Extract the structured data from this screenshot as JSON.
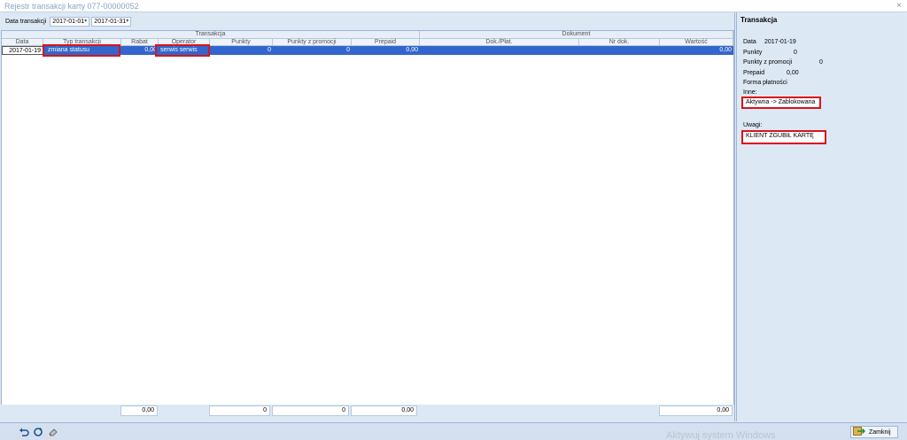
{
  "window": {
    "title": "Rejestr transakcji karty 077-00000052",
    "close_glyph": "×"
  },
  "filter": {
    "label": "Data transakcji",
    "from": "2017-01-01",
    "to": "2017-01-31"
  },
  "grid": {
    "bands": {
      "transakcja": "Transakcja",
      "dokument": "Dokument"
    },
    "columns": {
      "data": "Data",
      "typ": "Typ transakcji",
      "rabat": "Rabat",
      "operator": "Operator",
      "punkty": "Punkty",
      "punkty_promocji": "Punkty z promocji",
      "prepaid": "Prepaid",
      "dok": "Dok./Płat.",
      "nrdok": "Nr dok.",
      "wartosc": "Wartość"
    },
    "row": {
      "data": "2017-01-19",
      "typ": "zmiana statusu",
      "rabat": "0,00",
      "operator": "serwis serwis",
      "punkty": "0",
      "punkty_promocji": "0",
      "prepaid": "0,00",
      "dok": "",
      "nrdok": "",
      "wartosc": "0,00"
    },
    "totals": {
      "rabat": "0,00",
      "punkty": "0",
      "punkty_promocji": "0",
      "prepaid": "0,00",
      "wartosc": "0,00"
    }
  },
  "details": {
    "header": "Transakcja",
    "data_label": "Data",
    "data_value": "2017-01-19",
    "punkty_label": "Punkty",
    "punkty_value": "0",
    "punkty_promocji_label": "Punkty z promocji",
    "punkty_promocji_value": "0",
    "prepaid_label": "Prepaid",
    "prepaid_value": "0,00",
    "forma_label": "Forma płatności",
    "inne_label": "Inne:",
    "inne_value": "Aktywna -> Zablokowana",
    "uwagi_label": "Uwagi:",
    "uwagi_value": "KLIENT ZGUBIŁ KARTĘ"
  },
  "bottom": {
    "close_label": "Zamknij",
    "watermark": "Aktywuj system Windows"
  },
  "icons": {
    "close": "close-icon",
    "dropdown": "chevron-down-icon",
    "undo": "undo-icon",
    "refresh": "refresh-icon",
    "eraser": "eraser-icon",
    "exit": "exit-icon"
  },
  "colors": {
    "selection": "#3366cc",
    "highlight": "#d9141a",
    "panel": "#dde8f5"
  }
}
